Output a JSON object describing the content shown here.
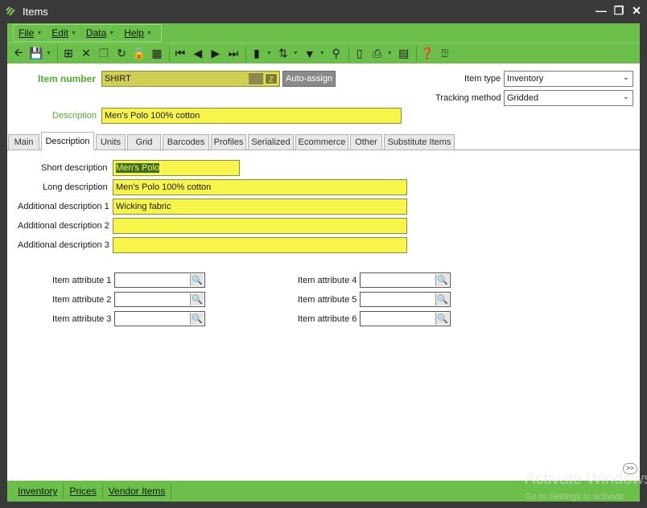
{
  "window": {
    "title": "Items"
  },
  "menu": [
    {
      "label": "File",
      "key": "F"
    },
    {
      "label": "Edit",
      "key": "E"
    },
    {
      "label": "Data",
      "key": "D"
    },
    {
      "label": "Help",
      "key": "H"
    }
  ],
  "header": {
    "item_number_label": "Item number",
    "item_number_value": "SHIRT",
    "auto_assign_label": "Auto-assign",
    "description_label": "Description",
    "description_value": "Men's Polo 100% cotton",
    "item_type_label": "Item type",
    "item_type_value": "Inventory",
    "tracking_method_label": "Tracking method",
    "tracking_method_value": "Gridded"
  },
  "tabs": [
    "Main",
    "Description",
    "Units",
    "Grid",
    "Barcodes",
    "Profiles",
    "Serialized",
    "Ecommerce",
    "Other",
    "Substitute Items"
  ],
  "active_tab": "Description",
  "description_tab": {
    "short_label": "Short description",
    "short_value": "Men's Polo",
    "long_label": "Long description",
    "long_value": "Men's Polo 100% cotton",
    "add1_label": "Additional description 1",
    "add1_value": "Wicking fabric",
    "add2_label": "Additional description 2",
    "add2_value": "",
    "add3_label": "Additional description 3",
    "add3_value": "",
    "attr1_label": "Item attribute 1",
    "attr2_label": "Item attribute 2",
    "attr3_label": "Item attribute 3",
    "attr4_label": "Item attribute 4",
    "attr5_label": "Item attribute 5",
    "attr6_label": "Item attribute 6"
  },
  "more_button": ">>",
  "bottom_tabs": [
    "Inventory",
    "Prices",
    "Vendor Items"
  ],
  "watermark": {
    "line1": "Activate Windows",
    "line2": "Go to Settings to activate"
  },
  "colors": {
    "accent_green": "#6cbf4a",
    "field_yellow": "#f7f54a",
    "label_green": "#4caf2e"
  }
}
